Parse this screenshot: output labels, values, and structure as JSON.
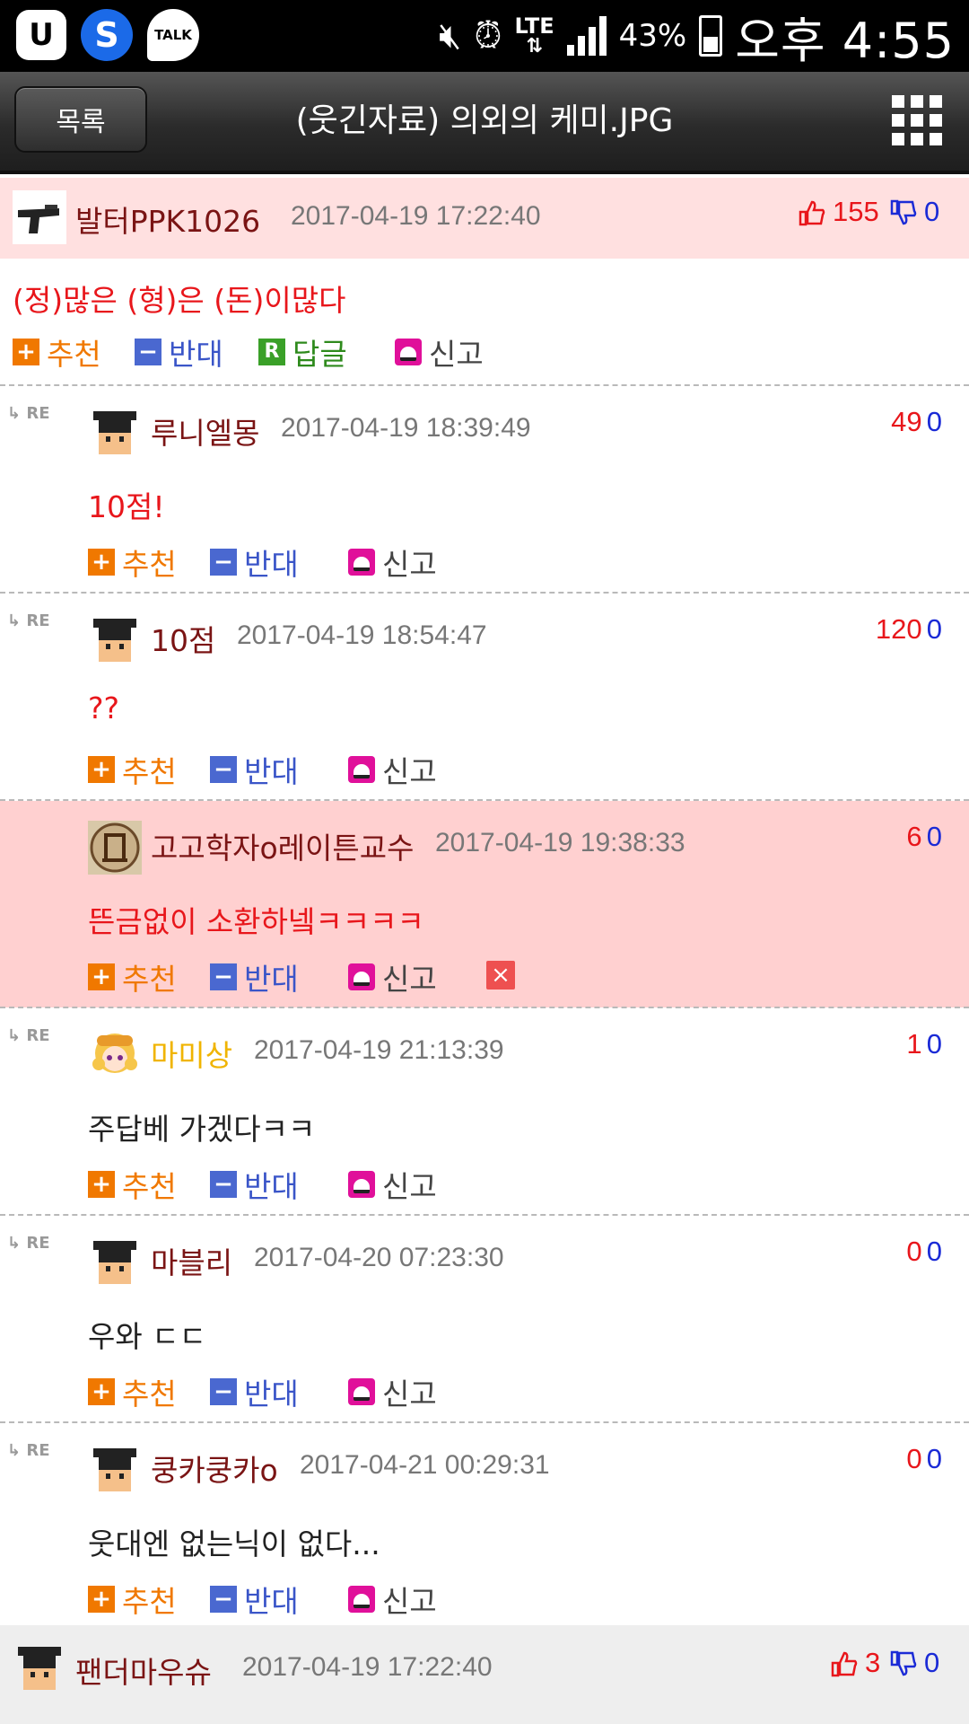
{
  "status_bar": {
    "icons_left": [
      "u-plus-icon",
      "s-app-icon",
      "kakaotalk-icon"
    ],
    "talk_label": "TALK",
    "network": "LTE",
    "battery": "43%",
    "time": "오후 4:55"
  },
  "header": {
    "list_button": "목록",
    "title": "(웃긴자료) 의외의 케미.JPG",
    "menu_icon": "grid-menu-icon"
  },
  "post": {
    "author": "발터PPK1026",
    "date": "2017-04-19 17:22:40",
    "likes": "155",
    "dislikes": "0",
    "text": "(정)많은 (형)은 (돈)이많다",
    "actions": {
      "recommend": "추천",
      "oppose": "반대",
      "reply": "답글",
      "report": "신고"
    }
  },
  "comments": [
    {
      "re": "RE",
      "author": "루니엘몽",
      "date": "2017-04-19 18:39:49",
      "likes": "49",
      "dislikes": "0",
      "text": "10점!",
      "text_color": "red",
      "highlight": false,
      "avatar": "graduate-avatar"
    },
    {
      "re": "RE",
      "author": "10점",
      "date": "2017-04-19 18:54:47",
      "likes": "120",
      "dislikes": "0",
      "text": "??",
      "text_color": "red",
      "highlight": false,
      "avatar": "graduate-avatar"
    },
    {
      "re": "",
      "author": "고고학자o레이튼교수",
      "date": "2017-04-19 19:38:33",
      "likes": "6",
      "dislikes": "0",
      "text": "뜬금없이 소환하넼ㅋㅋㅋㅋ",
      "text_color": "red",
      "highlight": true,
      "avatar": "professor-layton-avatar"
    },
    {
      "re": "RE",
      "author": "마미상",
      "date": "2017-04-19 21:13:39",
      "likes": "1",
      "dislikes": "0",
      "text": "주답베 가겠다ㅋㅋ",
      "text_color": "black",
      "highlight": false,
      "avatar": "anime-girl-avatar"
    },
    {
      "re": "RE",
      "author": "마블리",
      "date": "2017-04-20 07:23:30",
      "likes": "0",
      "dislikes": "0",
      "text": "우와 ㄷㄷ",
      "text_color": "black",
      "highlight": false,
      "avatar": "graduate-avatar"
    },
    {
      "re": "RE",
      "author": "쿵카쿵카o",
      "date": "2017-04-21 00:29:31",
      "likes": "0",
      "dislikes": "0",
      "text": "웃대엔 없는닉이 없다...",
      "text_color": "black",
      "highlight": false,
      "avatar": "graduate-avatar"
    }
  ],
  "comment_actions": {
    "recommend": "추천",
    "oppose": "반대",
    "report": "신고",
    "delete_icon": "close-icon"
  },
  "next_post": {
    "author": "팬더마우슈",
    "date": "2017-04-19 17:22:40",
    "likes": "3",
    "dislikes": "0"
  },
  "colors": {
    "post_header_bg": "#ffe0e0",
    "highlight_bg": "#ffd0d0",
    "like_red": "#e8161b",
    "dislike_blue": "#1b2bd6",
    "recommend_orange": "#f07800",
    "nick_dark_red": "#7a1414"
  }
}
